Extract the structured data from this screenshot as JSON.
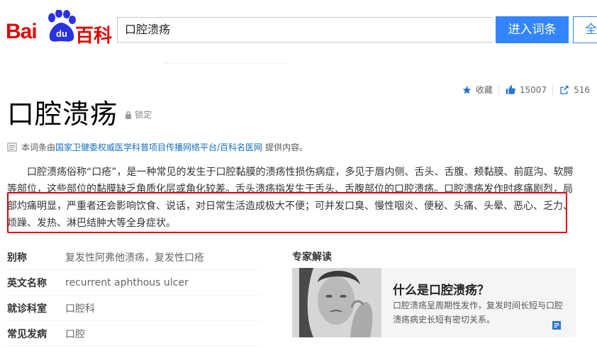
{
  "header": {
    "logo_left": "Bai",
    "logo_paw": "du",
    "logo_right": "百科",
    "search_value": "口腔溃疡",
    "search_button": "进入词条",
    "all_button": "全"
  },
  "stats": {
    "collect_label": "收藏",
    "likes": "15007",
    "shares": "516"
  },
  "entry": {
    "title": "口腔溃疡",
    "lock_label": "锁定",
    "source_prefix": "本词条由",
    "source_link": "国家卫健委权威医学科普项目传播网络平台/百科名医网",
    "source_suffix": "提供内容。",
    "summary": "口腔溃疡俗称“口疮”，是一种常见的发生于口腔黏膜的溃疡性损伤病症，多见于唇内侧、舌头、舌腹、颊黏膜、前庭沟、软腭等部位，这些部位的黏膜缺乏角质化层或角化较差。舌头溃疡指发生于舌头、舌腹部位的口腔溃疡。口腔溃疡发作时疼痛剧烈，局部灼痛明显，严重者还会影响饮食、说话，对日常生活造成极大不便；可并发口臭、慢性咽炎、便秘、头痛、头晕、恶心、乏力、烦躁、发热、淋巴结肿大等全身症状。"
  },
  "basic_info": [
    {
      "label": "别称",
      "value": "复发性阿弗他溃疡，复发性口疮"
    },
    {
      "label": "英文名称",
      "value": "recurrent  aphthous ulcer"
    },
    {
      "label": "就诊科室",
      "value": "口腔科"
    },
    {
      "label": "常见发病",
      "value": "口腔"
    }
  ],
  "expert": {
    "section_title": "专家解读",
    "question": "什么是口腔溃疡？",
    "desc": "口腔溃疡呈周期性发作，复发时间长短与口腔溃疡病史长短有密切关系。"
  },
  "colors": {
    "brand_red": "#e10601",
    "accent_blue": "#3385ff",
    "link_blue": "#136ec2",
    "highlight_red": "#e3000f"
  },
  "icons": [
    "baidu-paw-icon",
    "star-icon",
    "thumb-up-icon",
    "share-icon",
    "lock-icon",
    "document-icon",
    "doctor-note-icon"
  ]
}
